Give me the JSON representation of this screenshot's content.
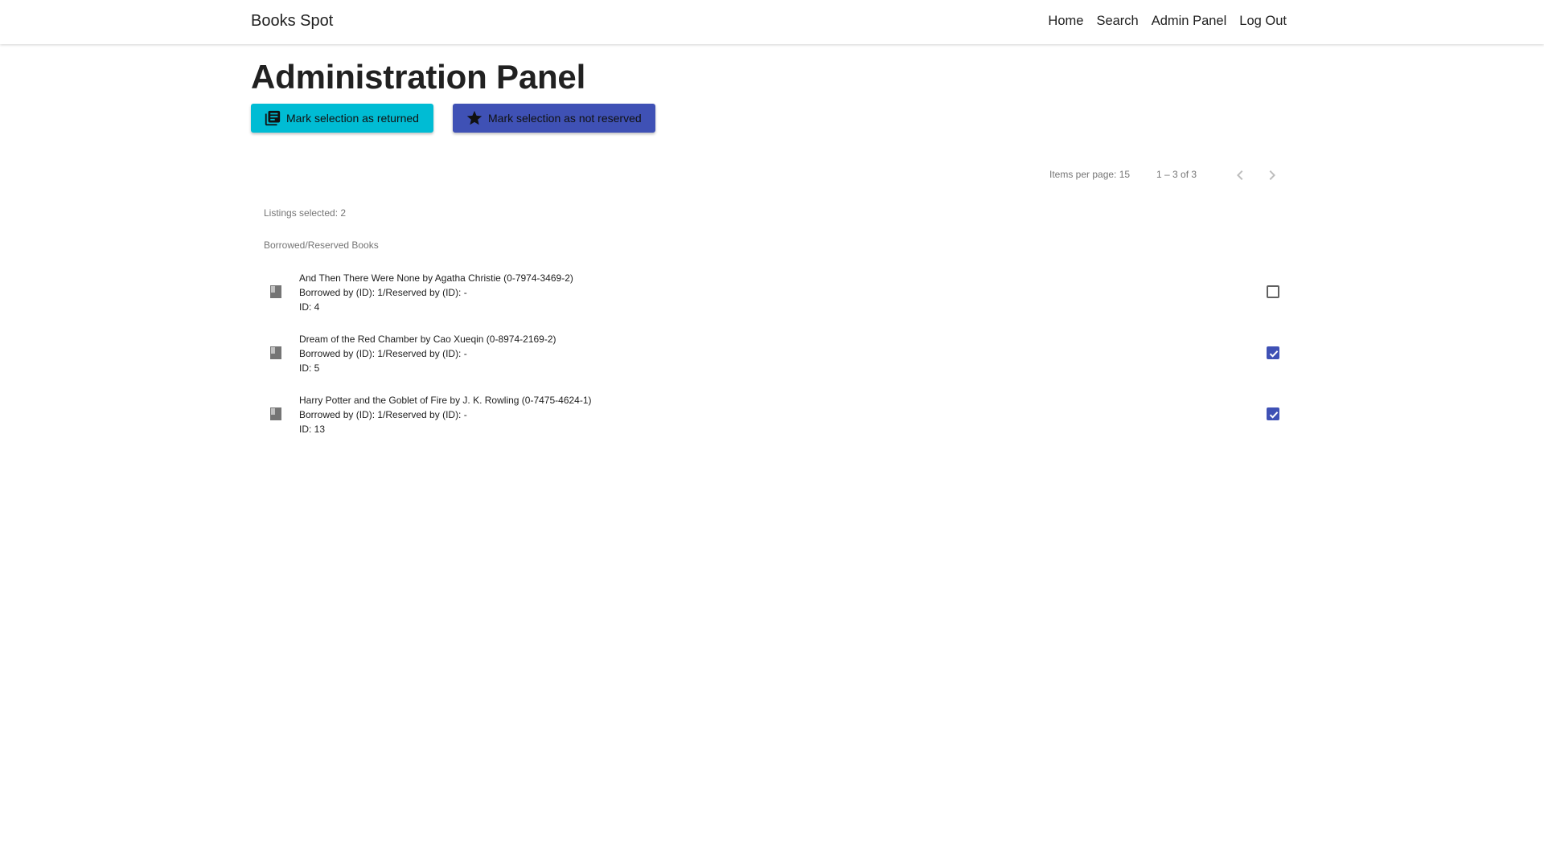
{
  "navbar": {
    "brand": "Books Spot",
    "links": [
      "Home",
      "Search",
      "Admin Panel",
      "Log Out"
    ]
  },
  "page": {
    "title": "Administration Panel"
  },
  "actions": {
    "returned_label": "Mark selection as returned",
    "returned_icon": "library-books-icon",
    "returned_color": "#00bcd4",
    "not_reserved_label": "Mark selection as not reserved",
    "not_reserved_icon": "star-icon",
    "not_reserved_color": "#3f51b5"
  },
  "paginator": {
    "items_per_page_label": "Items per page: 15",
    "range": "1 – 3 of 3"
  },
  "selection": {
    "count_text": "Listings selected: 2"
  },
  "list": {
    "subheader": "Borrowed/Reserved Books",
    "items": [
      {
        "title": "And Then There Were None by Agatha Christie (0-7974-3469-2)",
        "status": "Borrowed by (ID): 1/Reserved by (ID): -",
        "id": "ID: 4",
        "checked": false
      },
      {
        "title": "Dream of the Red Chamber by Cao Xueqin (0-8974-2169-2)",
        "status": "Borrowed by (ID): 1/Reserved by (ID): -",
        "id": "ID: 5",
        "checked": true
      },
      {
        "title": "Harry Potter and the Goblet of Fire by J. K. Rowling (0-7475-4624-1)",
        "status": "Borrowed by (ID): 1/Reserved by (ID): -",
        "id": "ID: 13",
        "checked": true
      }
    ]
  }
}
